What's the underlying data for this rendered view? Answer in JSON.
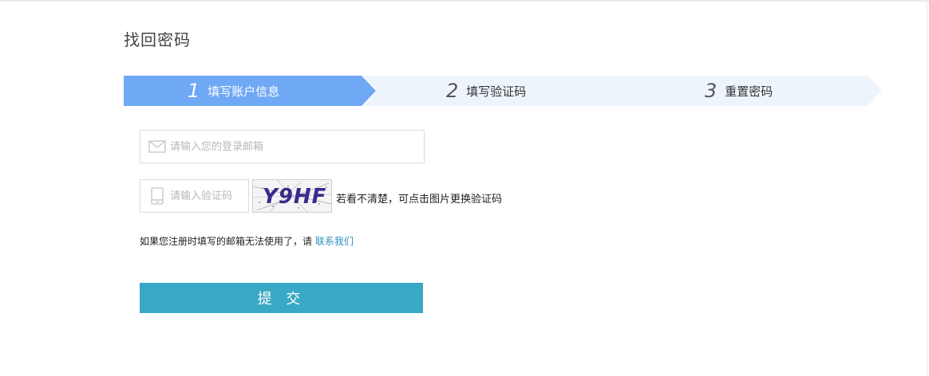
{
  "page": {
    "title": "找回密码"
  },
  "steps": [
    {
      "number": "1",
      "label": "填写账户信息",
      "active": true
    },
    {
      "number": "2",
      "label": "填写验证码",
      "active": false
    },
    {
      "number": "3",
      "label": "重置密码",
      "active": false
    }
  ],
  "colors": {
    "step_active": "#6fa8f4",
    "step_inactive": "#eef4fc",
    "submit": "#39a8c4",
    "link": "#2a8fbd"
  },
  "form": {
    "email_placeholder": "请输入您的登录邮箱",
    "email_icon": "mail-icon",
    "code_placeholder": "请输入验证码",
    "code_icon": "phone-icon",
    "captcha_text": "Y9HF",
    "captcha_hint": "若看不清楚，可点击图片更换验证码",
    "note_text": "如果您注册时填写的邮箱无法使用了，请",
    "note_link": "联系我们",
    "submit_label": "提 交"
  }
}
